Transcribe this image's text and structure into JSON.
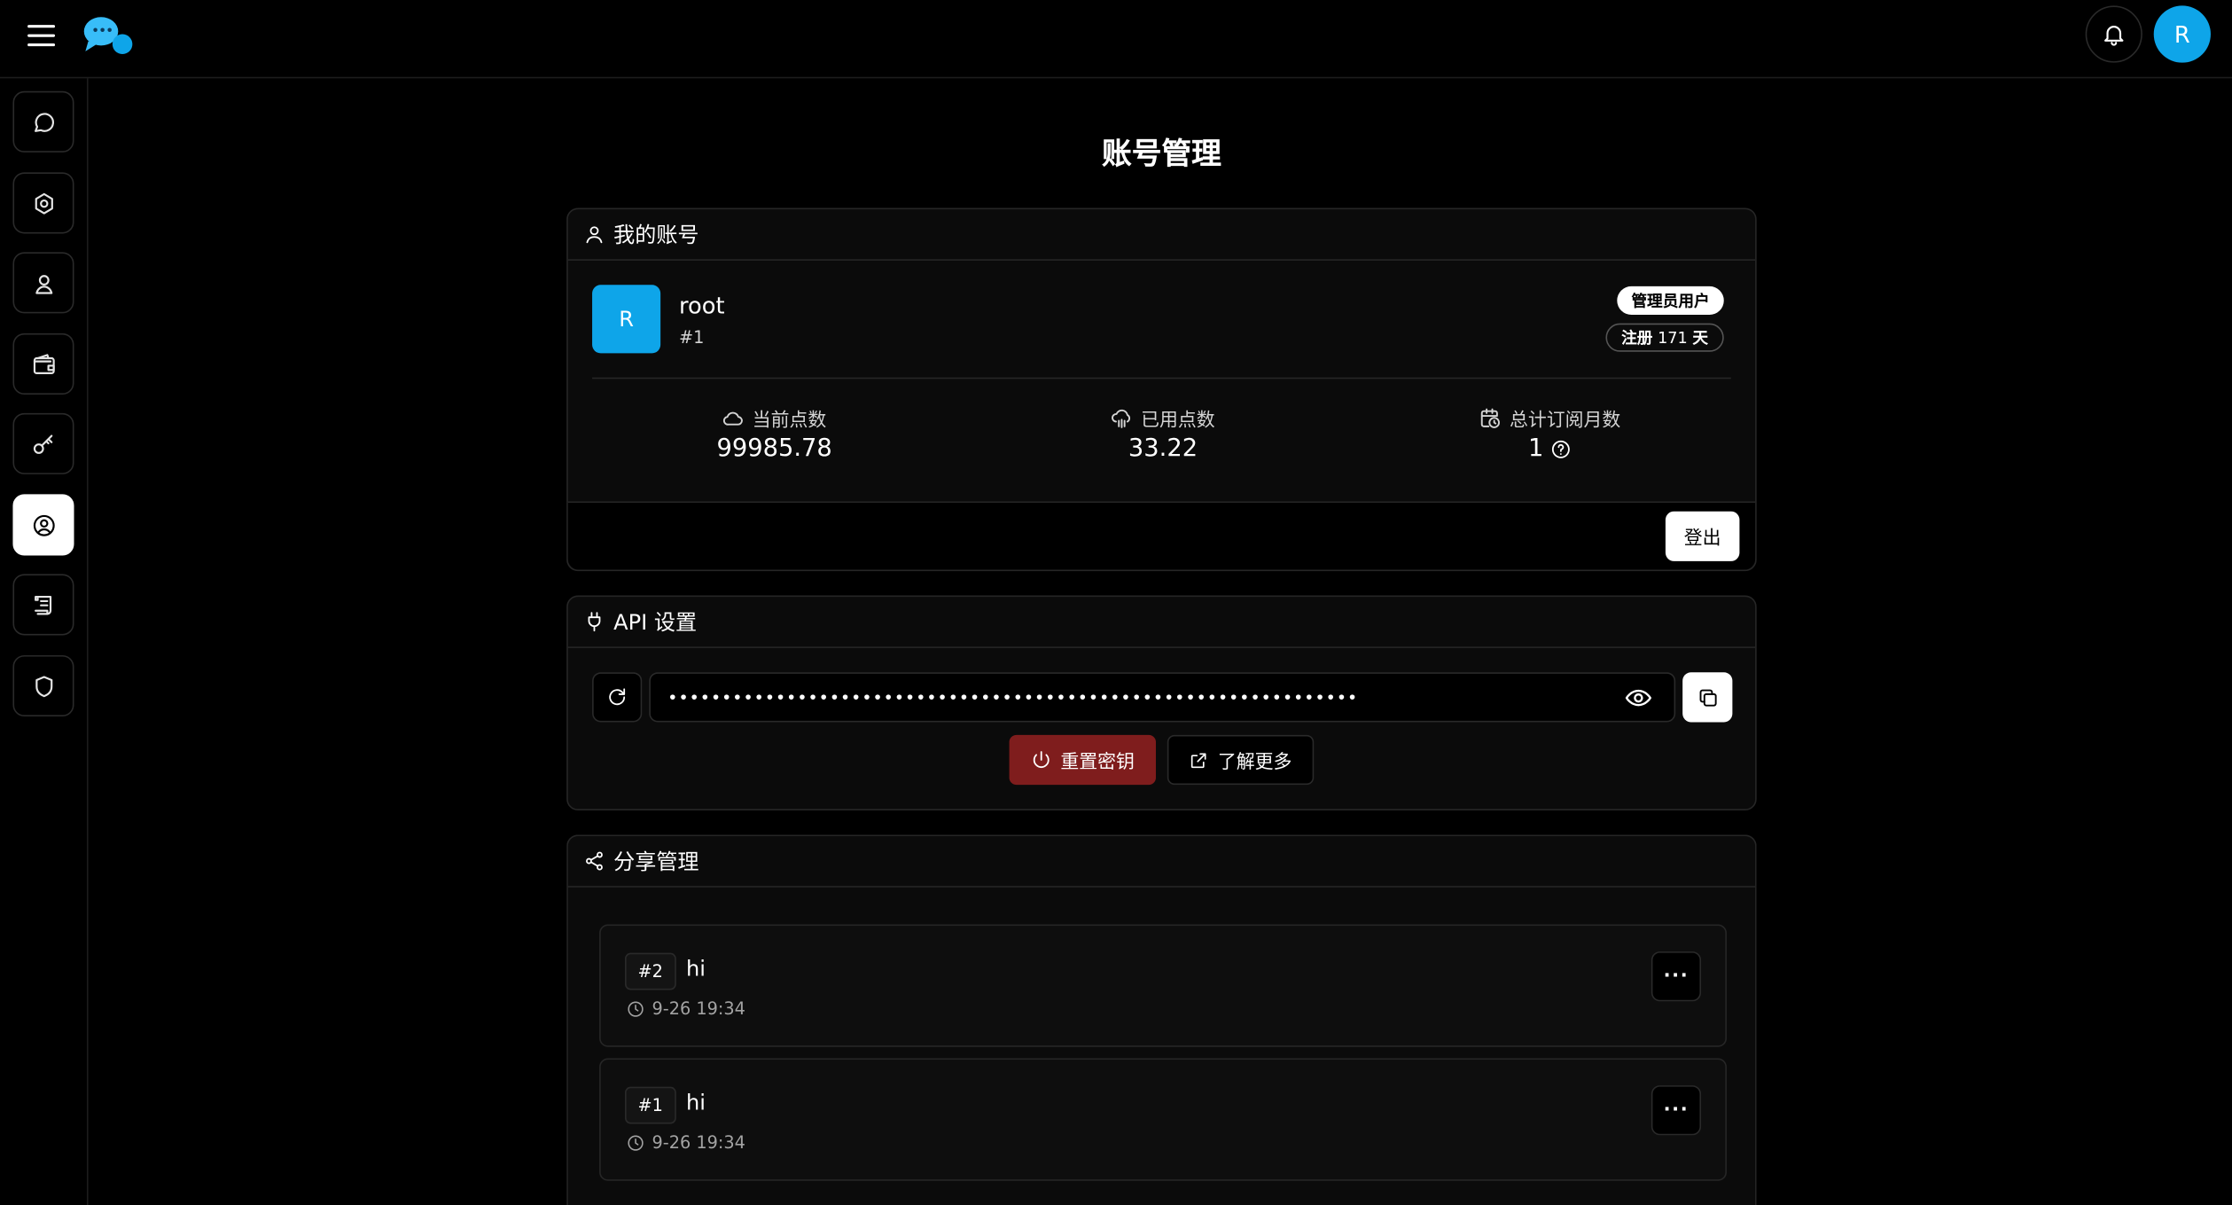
{
  "header": {
    "avatar_initial": "R"
  },
  "sidebar": {
    "items": [
      {
        "icon": "chat-icon",
        "active": false
      },
      {
        "icon": "settings-icon",
        "active": false
      },
      {
        "icon": "user-location-icon",
        "active": false
      },
      {
        "icon": "wallet-icon",
        "active": false
      },
      {
        "icon": "key-icon",
        "active": false
      },
      {
        "icon": "user-circle-icon",
        "active": true
      },
      {
        "icon": "scroll-icon",
        "active": false
      },
      {
        "icon": "shield-icon",
        "active": false
      }
    ]
  },
  "page": {
    "title": "账号管理"
  },
  "account": {
    "section_title": "我的账号",
    "avatar_initial": "R",
    "username": "root",
    "user_id": "#1",
    "role_badge": "管理员用户",
    "reg_label": "注册",
    "reg_days": "171",
    "reg_unit": "天",
    "stats": [
      {
        "label": "当前点数",
        "value": "99985.78",
        "icon": "cloud-icon"
      },
      {
        "label": "已用点数",
        "value": "33.22",
        "icon": "cloud-rain-icon"
      },
      {
        "label": "总计订阅月数",
        "value": "1",
        "icon": "calendar-clock-icon"
      }
    ],
    "logout_label": "登出"
  },
  "api": {
    "section_title": "API 设置",
    "masked_key": "••••••••••••••••••••••••••••••••••••••••••••••••••••••••••••••••",
    "reset_label": "重置密钥",
    "learn_more_label": "了解更多"
  },
  "share": {
    "section_title": "分享管理",
    "items": [
      {
        "id": "#2",
        "title": "hi",
        "time": "9-26 19:34"
      },
      {
        "id": "#1",
        "title": "hi",
        "time": "9-26 19:34"
      }
    ],
    "more_label": "···"
  },
  "colors": {
    "accent": "#0ea5e9",
    "danger": "#7f1d1d",
    "background": "#000000"
  }
}
